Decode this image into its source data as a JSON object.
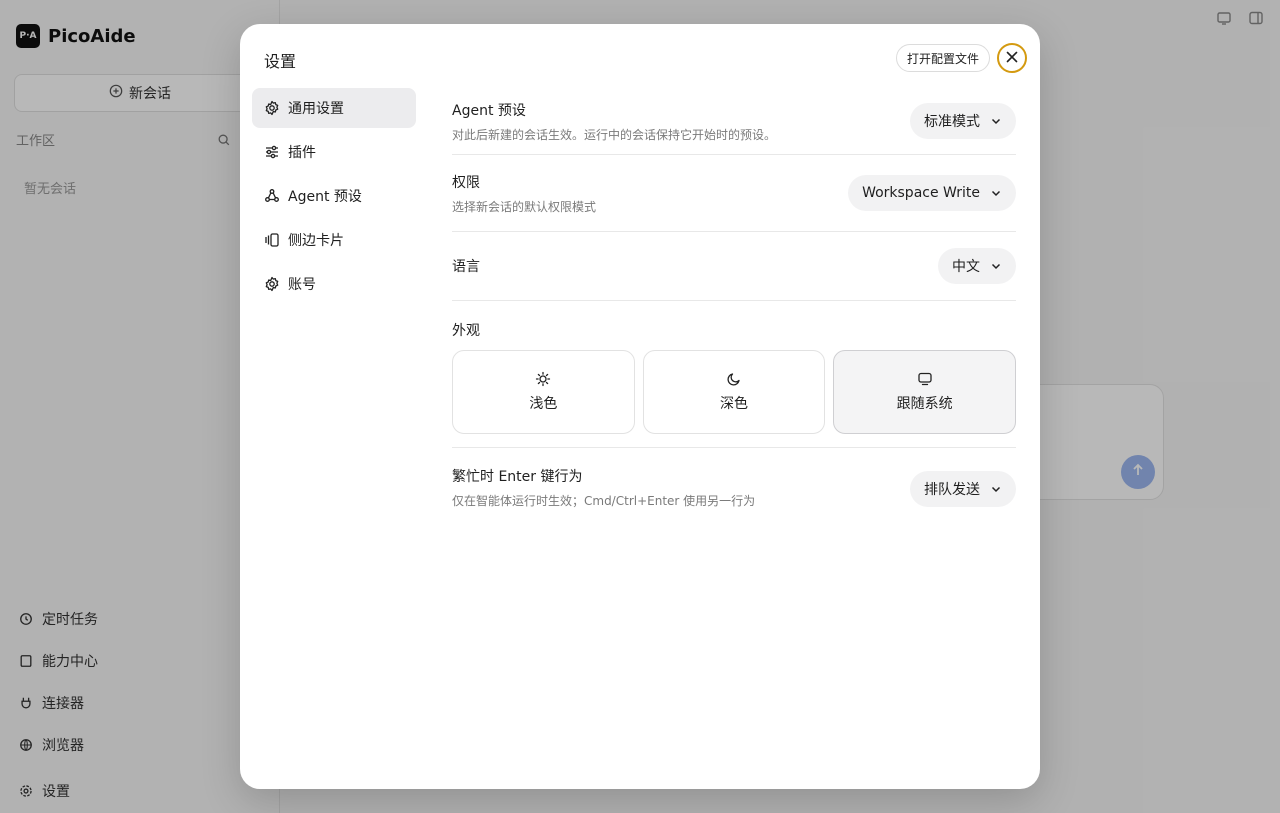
{
  "background": {
    "brand": {
      "logo_text": "P·A",
      "name": "PicoAide"
    },
    "new_chat_label": "新会话",
    "workspace_label": "工作区",
    "empty_sessions": "暂无会话",
    "nav": [
      {
        "label": "定时任务"
      },
      {
        "label": "能力中心"
      },
      {
        "label": "连接器"
      },
      {
        "label": "浏览器"
      },
      {
        "label": "设置"
      }
    ]
  },
  "modal": {
    "title": "设置",
    "open_config_label": "打开配置文件",
    "nav": [
      {
        "label": "通用设置",
        "icon": "gear-icon",
        "active": true
      },
      {
        "label": "插件",
        "icon": "sliders-icon",
        "active": false
      },
      {
        "label": "Agent 预设",
        "icon": "agent-icon",
        "active": false
      },
      {
        "label": "侧边卡片",
        "icon": "cards-icon",
        "active": false
      },
      {
        "label": "账号",
        "icon": "gear-icon",
        "active": false
      }
    ],
    "settings": {
      "agent_preset": {
        "label": "Agent 预设",
        "desc": "对此后新建的会话生效。运行中的会话保持它开始时的预设。",
        "value": "标准模式"
      },
      "permission": {
        "label": "权限",
        "desc": "选择新会话的默认权限模式",
        "value": "Workspace Write"
      },
      "language": {
        "label": "语言",
        "value": "中文"
      },
      "appearance": {
        "label": "外观",
        "options": [
          {
            "label": "浅色",
            "icon": "sun-icon",
            "selected": false
          },
          {
            "label": "深色",
            "icon": "moon-icon",
            "selected": false
          },
          {
            "label": "跟随系统",
            "icon": "monitor-icon",
            "selected": true
          }
        ]
      },
      "busy_enter": {
        "label": "繁忙时 Enter 键行为",
        "desc": "仅在智能体运行时生效；Cmd/Ctrl+Enter 使用另一行为",
        "value": "排队发送"
      }
    }
  },
  "colors": {
    "accent_focus": "#d49a10",
    "active_bg": "#ececee",
    "overlay": "rgba(0,0,0,0.28)"
  }
}
